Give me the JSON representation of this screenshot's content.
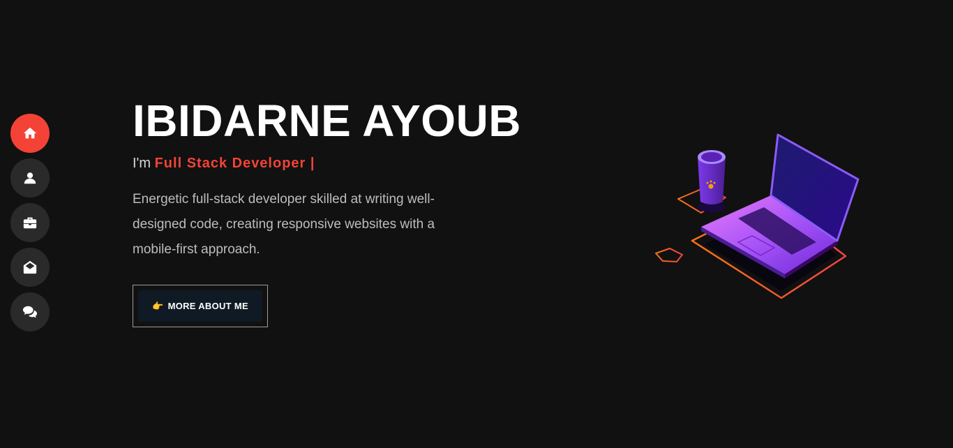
{
  "nav": {
    "items": [
      {
        "icon": "home-icon",
        "active": true
      },
      {
        "icon": "user-icon",
        "active": false
      },
      {
        "icon": "briefcase-icon",
        "active": false
      },
      {
        "icon": "envelope-open-icon",
        "active": false
      },
      {
        "icon": "comments-icon",
        "active": false
      }
    ]
  },
  "hero": {
    "name": "IBIDARNE AYOUB",
    "role_prefix": "I'm ",
    "role_typed": "Full Stack Developer |",
    "description": "Energetic full-stack developer skilled at writing well-designed code, creating responsive websites with a mobile-first approach.",
    "button_icon": "👉",
    "button_label": "MORE ABOUT ME"
  },
  "colors": {
    "background": "#111111",
    "accent": "#f44336",
    "nav_button": "#2b2a2a"
  }
}
